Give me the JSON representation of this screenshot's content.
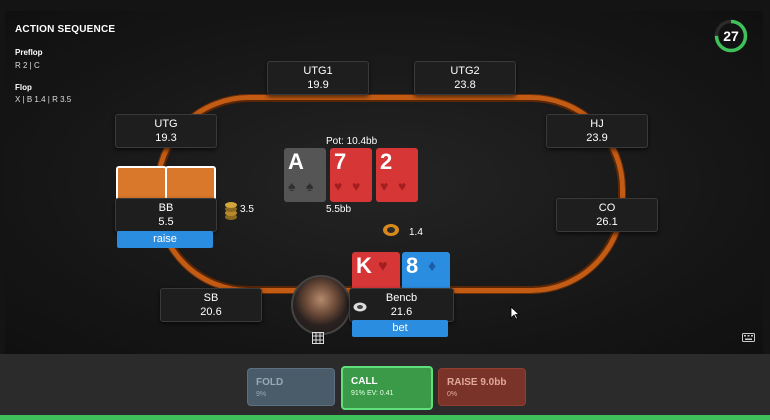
{
  "sequence": {
    "title": "ACTION SEQUENCE",
    "streets": [
      {
        "name": "Preflop",
        "actions": "R 2  |  C"
      },
      {
        "name": "Flop",
        "actions": "X  |  B 1.4  |  R 3.5"
      }
    ]
  },
  "timer": {
    "value": "27",
    "fraction_remaining": 0.75
  },
  "seats": {
    "utg1": {
      "name": "UTG1",
      "stack": "19.9"
    },
    "utg2": {
      "name": "UTG2",
      "stack": "23.8"
    },
    "utg": {
      "name": "UTG",
      "stack": "19.3"
    },
    "hj": {
      "name": "HJ",
      "stack": "23.9"
    },
    "bb": {
      "name": "BB",
      "stack": "5.5",
      "action": "raise",
      "bet": "3.5"
    },
    "co": {
      "name": "CO",
      "stack": "26.1"
    },
    "sb": {
      "name": "SB",
      "stack": "20.6"
    },
    "hero": {
      "name": "Bencb",
      "stack": "21.6",
      "action": "bet",
      "bet": "1.4"
    }
  },
  "board": {
    "pot_label": "Pot: 10.4bb",
    "sub_pot": "5.5bb",
    "cards": [
      {
        "rank": "A",
        "suit": "♠",
        "color": "#555555"
      },
      {
        "rank": "7",
        "suit": "♥",
        "color": "#d73636"
      },
      {
        "rank": "2",
        "suit": "♥",
        "color": "#d73636"
      }
    ]
  },
  "hero_cards": [
    {
      "rank": "K",
      "suit": "♥",
      "color": "#d73636"
    },
    {
      "rank": "8",
      "suit": "♦",
      "color": "#2a8de0"
    }
  ],
  "actions": {
    "fold": {
      "label": "FOLD",
      "sub": "9%"
    },
    "call": {
      "label": "CALL",
      "sub": "91%   EV: 0.41"
    },
    "raise": {
      "label": "RAISE 9.0bb",
      "sub": "0%"
    }
  },
  "colors": {
    "felt_rail": "#c25b14",
    "action_tag": "#2a8de0",
    "call_green": "#3ec15a"
  }
}
